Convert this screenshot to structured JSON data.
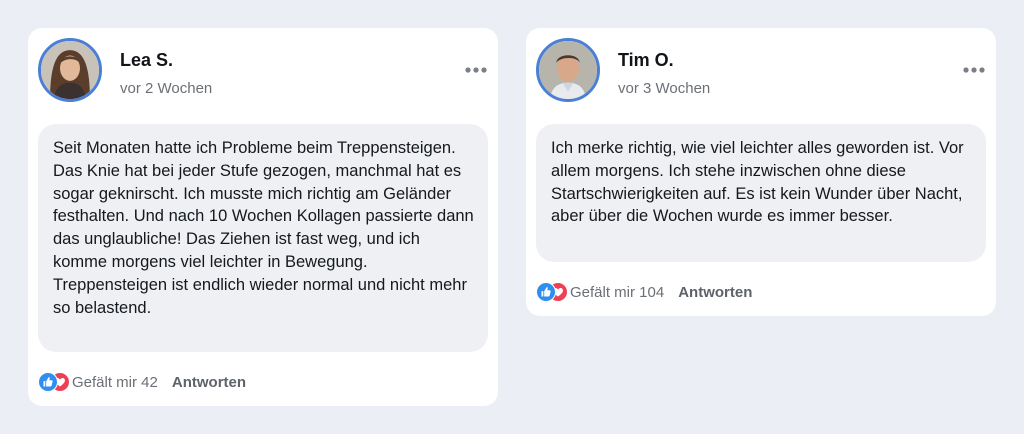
{
  "comments": [
    {
      "author": "Lea S.",
      "time": "vor 2 Wochen",
      "text": "Seit Monaten hatte ich Probleme beim Treppensteigen. Das Knie hat bei jeder Stufe gezogen, manchmal hat es sogar geknirscht. Ich musste mich richtig am Geländer festhalten. Und nach 10 Wochen Kollagen passierte dann das unglaubliche! Das Ziehen ist fast weg, und ich komme morgens viel leichter in Bewegung. Treppensteigen ist endlich wieder normal und nicht mehr so belastend.",
      "like_label": "Gefält mir 42",
      "reply_label": "Antworten"
    },
    {
      "author": "Tim O.",
      "time": "vor 3 Wochen",
      "text": "Ich merke richtig, wie viel leichter alles geworden ist. Vor allem morgens. Ich stehe inzwischen ohne diese Startschwierigkeiten auf. Es ist kein Wunder über Nacht, aber über die Wochen wurde es immer besser.",
      "like_label": "Gefält mir 104",
      "reply_label": "Antworten"
    }
  ],
  "icons": {
    "more": "more-dots-icon",
    "like": "thumbs-up-icon",
    "love": "heart-icon"
  },
  "colors": {
    "background": "#eceef6",
    "card": "#ffffff",
    "bubble": "#eef0f3",
    "avatar_ring": "#4a7fd6",
    "like_blue": "#2f8ff0",
    "love_red": "#ef3f55"
  }
}
